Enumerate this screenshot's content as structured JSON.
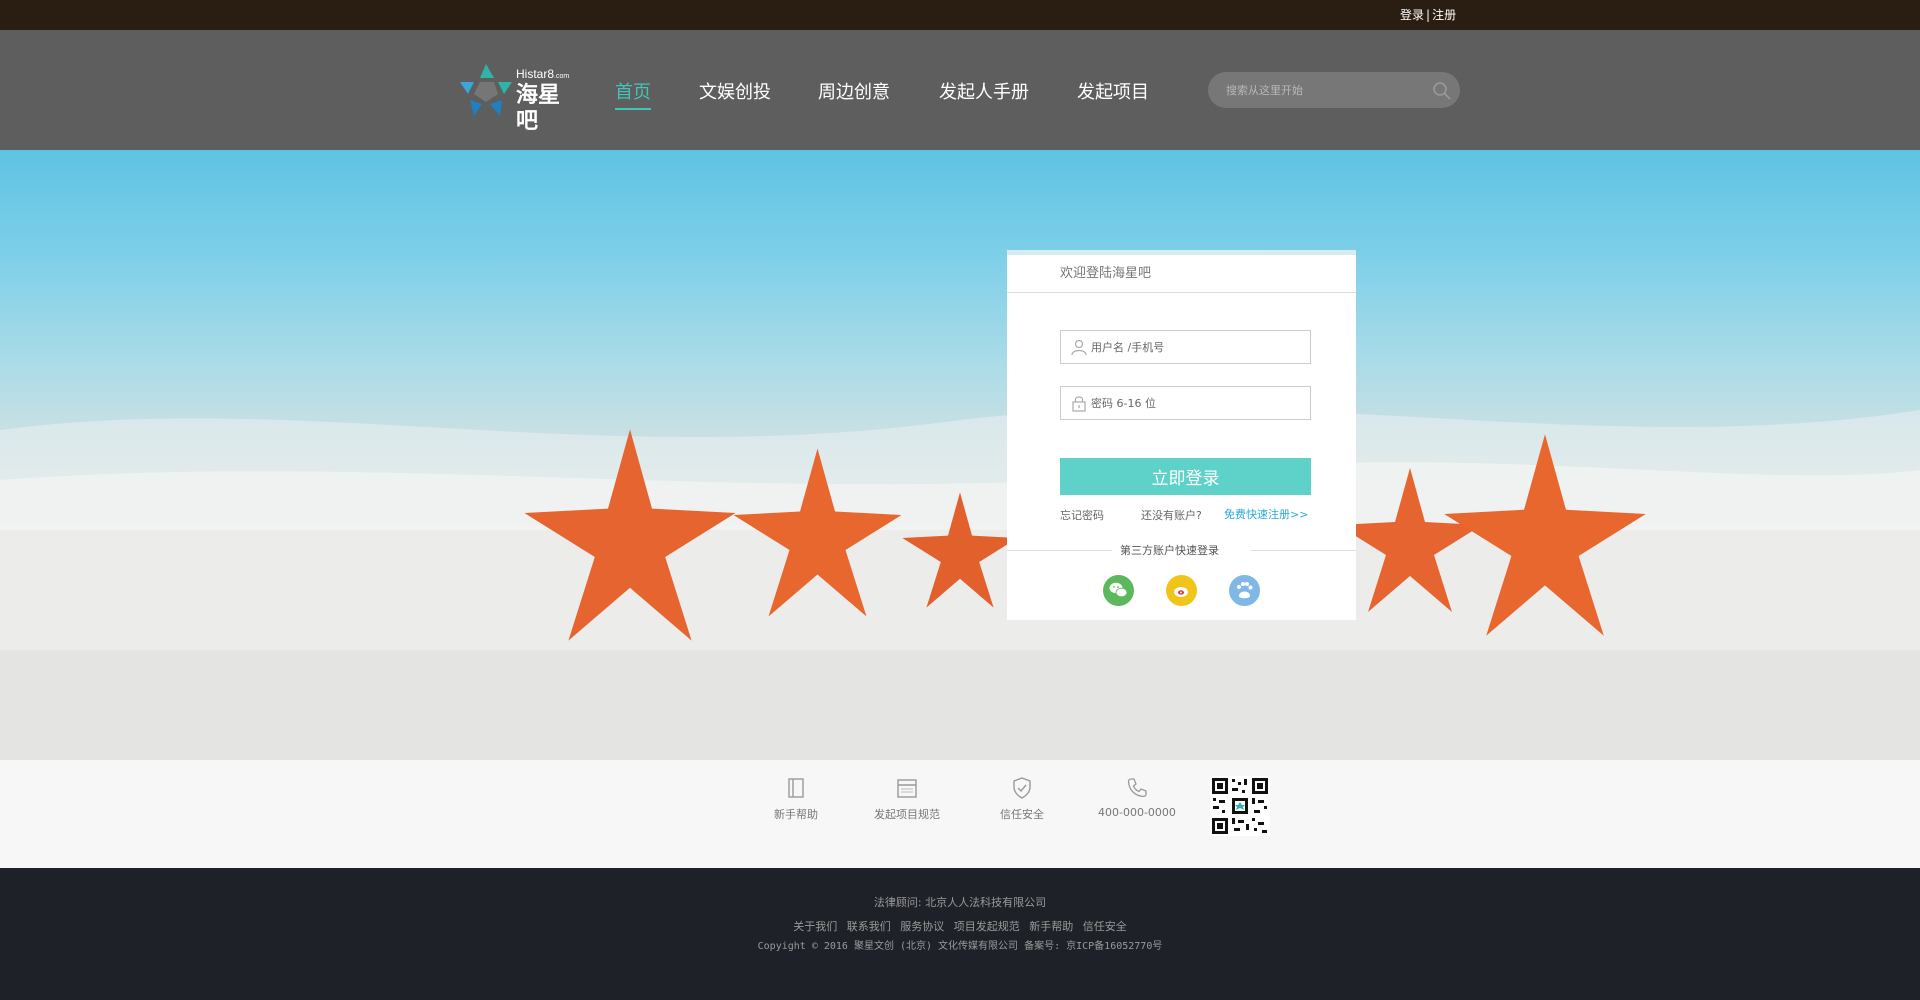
{
  "topbar": {
    "login": "登录",
    "separator": "|",
    "register": "注册"
  },
  "logo": {
    "en": "Histar8",
    "en_suffix": ".com",
    "cn": "海星吧"
  },
  "nav": [
    {
      "label": "首页",
      "active": true
    },
    {
      "label": "文娱创投",
      "active": false
    },
    {
      "label": "周边创意",
      "active": false
    },
    {
      "label": "发起人手册",
      "active": false
    },
    {
      "label": "发起项目",
      "active": false
    }
  ],
  "search": {
    "placeholder": "搜索从这里开始",
    "icon": "search-icon"
  },
  "login": {
    "title": "欢迎登陆海星吧",
    "username_placeholder": "用户名 /手机号",
    "password_placeholder": "密码 6-16 位",
    "submit": "立即登录",
    "forgot": "忘记密码",
    "no_account": "还没有账户?",
    "register": "免费快速注册>>",
    "third_party": "第三方账户快速登录",
    "social": [
      {
        "name": "wechat-icon",
        "color": "#5cb85c"
      },
      {
        "name": "weibo-icon",
        "color": "#f0c419"
      },
      {
        "name": "baidu-icon",
        "color": "#7fb7e6"
      }
    ]
  },
  "footer_links": [
    {
      "label": "新手帮助",
      "icon": "book-icon"
    },
    {
      "label": "发起项目规范",
      "icon": "calendar-icon"
    },
    {
      "label": "信任安全",
      "icon": "shield-icon"
    },
    {
      "label": "400-000-0000",
      "icon": "phone-icon"
    }
  ],
  "bottom": {
    "legal": "法律顾问: 北京人人法科技有限公司",
    "links": [
      "关于我们",
      "联系我们",
      "服务协议",
      "项目发起规范",
      "新手帮助",
      "信任安全"
    ],
    "copyright": "Copyight © 2016 聚星文创 (北京) 文化传媒有限公司 备案号: 京ICP备16052770号"
  },
  "colors": {
    "accent": "#43c4b6",
    "login_button": "#5ed2c8",
    "header_bg": "#5e5e5e",
    "topbar_bg": "#2a1d12",
    "bottom_bg": "#1f2129"
  }
}
